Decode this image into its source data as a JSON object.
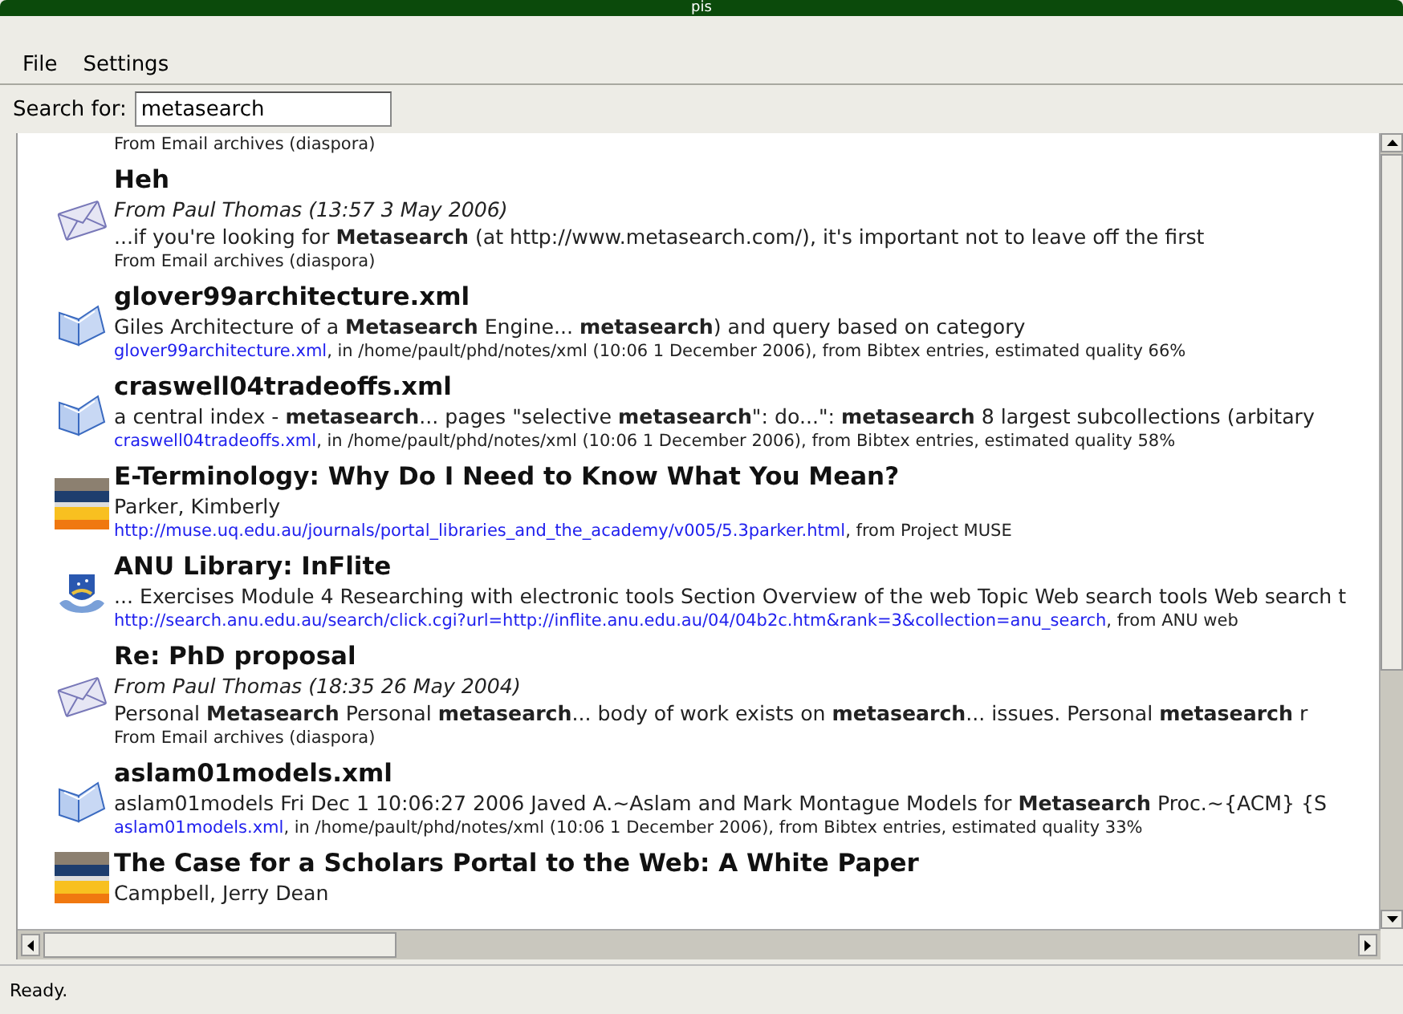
{
  "window": {
    "title": "pis"
  },
  "menu": [
    "File",
    "Settings"
  ],
  "search": {
    "label": "Search for:",
    "value": "metasearch"
  },
  "results": [
    {
      "lines": [
        {
          "kind": "meta",
          "text": "From Email archives (diaspora)"
        }
      ]
    },
    {
      "kind": "email",
      "title": "Heh",
      "lines": [
        {
          "kind": "from",
          "text": "From Paul Thomas (13:57 3 May 2006)"
        },
        {
          "kind": "snippet",
          "text": "...if you're looking for **Metasearch** (at http://www.metasearch.com/), it's important not to leave off the first"
        },
        {
          "kind": "meta",
          "text": "From Email archives (diaspora)"
        }
      ]
    },
    {
      "kind": "bibtex",
      "title": "glover99architecture.xml",
      "lines": [
        {
          "kind": "snippet",
          "text": " Giles Architecture of a **Metasearch** Engine... **metasearch**) and query based on category"
        },
        {
          "kind": "meta",
          "link": "glover99architecture.xml",
          "text": ", in /home/pault/phd/notes/xml (10:06 1 December 2006), from Bibtex entries, estimated quality 66%"
        }
      ]
    },
    {
      "kind": "bibtex",
      "title": "craswell04tradeoffs.xml",
      "lines": [
        {
          "kind": "snippet",
          "text": " a central index - **metasearch**... pages \"selective **metasearch**\": do...\": **metasearch** 8 largest subcollections (arbitary"
        },
        {
          "kind": "meta",
          "link": "craswell04tradeoffs.xml",
          "text": ", in /home/pault/phd/notes/xml (10:06 1 December 2006), from Bibtex entries, estimated quality 58%"
        }
      ]
    },
    {
      "kind": "journal",
      "title": "E-Terminology: Why Do I Need to Know What You Mean?",
      "lines": [
        {
          "kind": "author",
          "text": "Parker, Kimberly"
        },
        {
          "kind": "meta",
          "link": "http://muse.uq.edu.au/journals/portal_libraries_and_the_academy/v005/5.3parker.html",
          "text": ", from Project MUSE"
        }
      ]
    },
    {
      "kind": "web",
      "title": "ANU Library:  InFlite",
      "lines": [
        {
          "kind": "snippet",
          "text": "... Exercises Module 4 Researching with electronic tools Section Overview of the web Topic Web search tools Web search t"
        },
        {
          "kind": "meta",
          "link": "http://search.anu.edu.au/search/click.cgi?url=http://inflite.anu.edu.au/04/04b2c.htm&rank=3&collection=anu_search",
          "text": ", from ANU web"
        }
      ]
    },
    {
      "kind": "email",
      "title": "Re: PhD proposal",
      "lines": [
        {
          "kind": "from",
          "text": "From Paul Thomas (18:35 26 May 2004)"
        },
        {
          "kind": "snippet",
          "text": " Personal **Metasearch** Personal **metasearch**... body of work exists on **metasearch**... issues. Personal **metasearch** r"
        },
        {
          "kind": "meta",
          "text": "From Email archives (diaspora)"
        }
      ]
    },
    {
      "kind": "bibtex",
      "title": "aslam01models.xml",
      "lines": [
        {
          "kind": "snippet",
          "text": "aslam01models Fri Dec 1 10:06:27 2006 Javed A.~Aslam and Mark Montague Models for **Metasearch** Proc.~{ACM} {S"
        },
        {
          "kind": "meta",
          "link": "aslam01models.xml",
          "text": ", in /home/pault/phd/notes/xml (10:06 1 December 2006), from Bibtex entries, estimated quality 33%"
        }
      ]
    },
    {
      "kind": "journal",
      "title": "The Case for a Scholars Portal to the Web: A White Paper",
      "lines": [
        {
          "kind": "author",
          "text": "Campbell, Jerry Dean"
        }
      ]
    }
  ],
  "status_bar": "Ready."
}
